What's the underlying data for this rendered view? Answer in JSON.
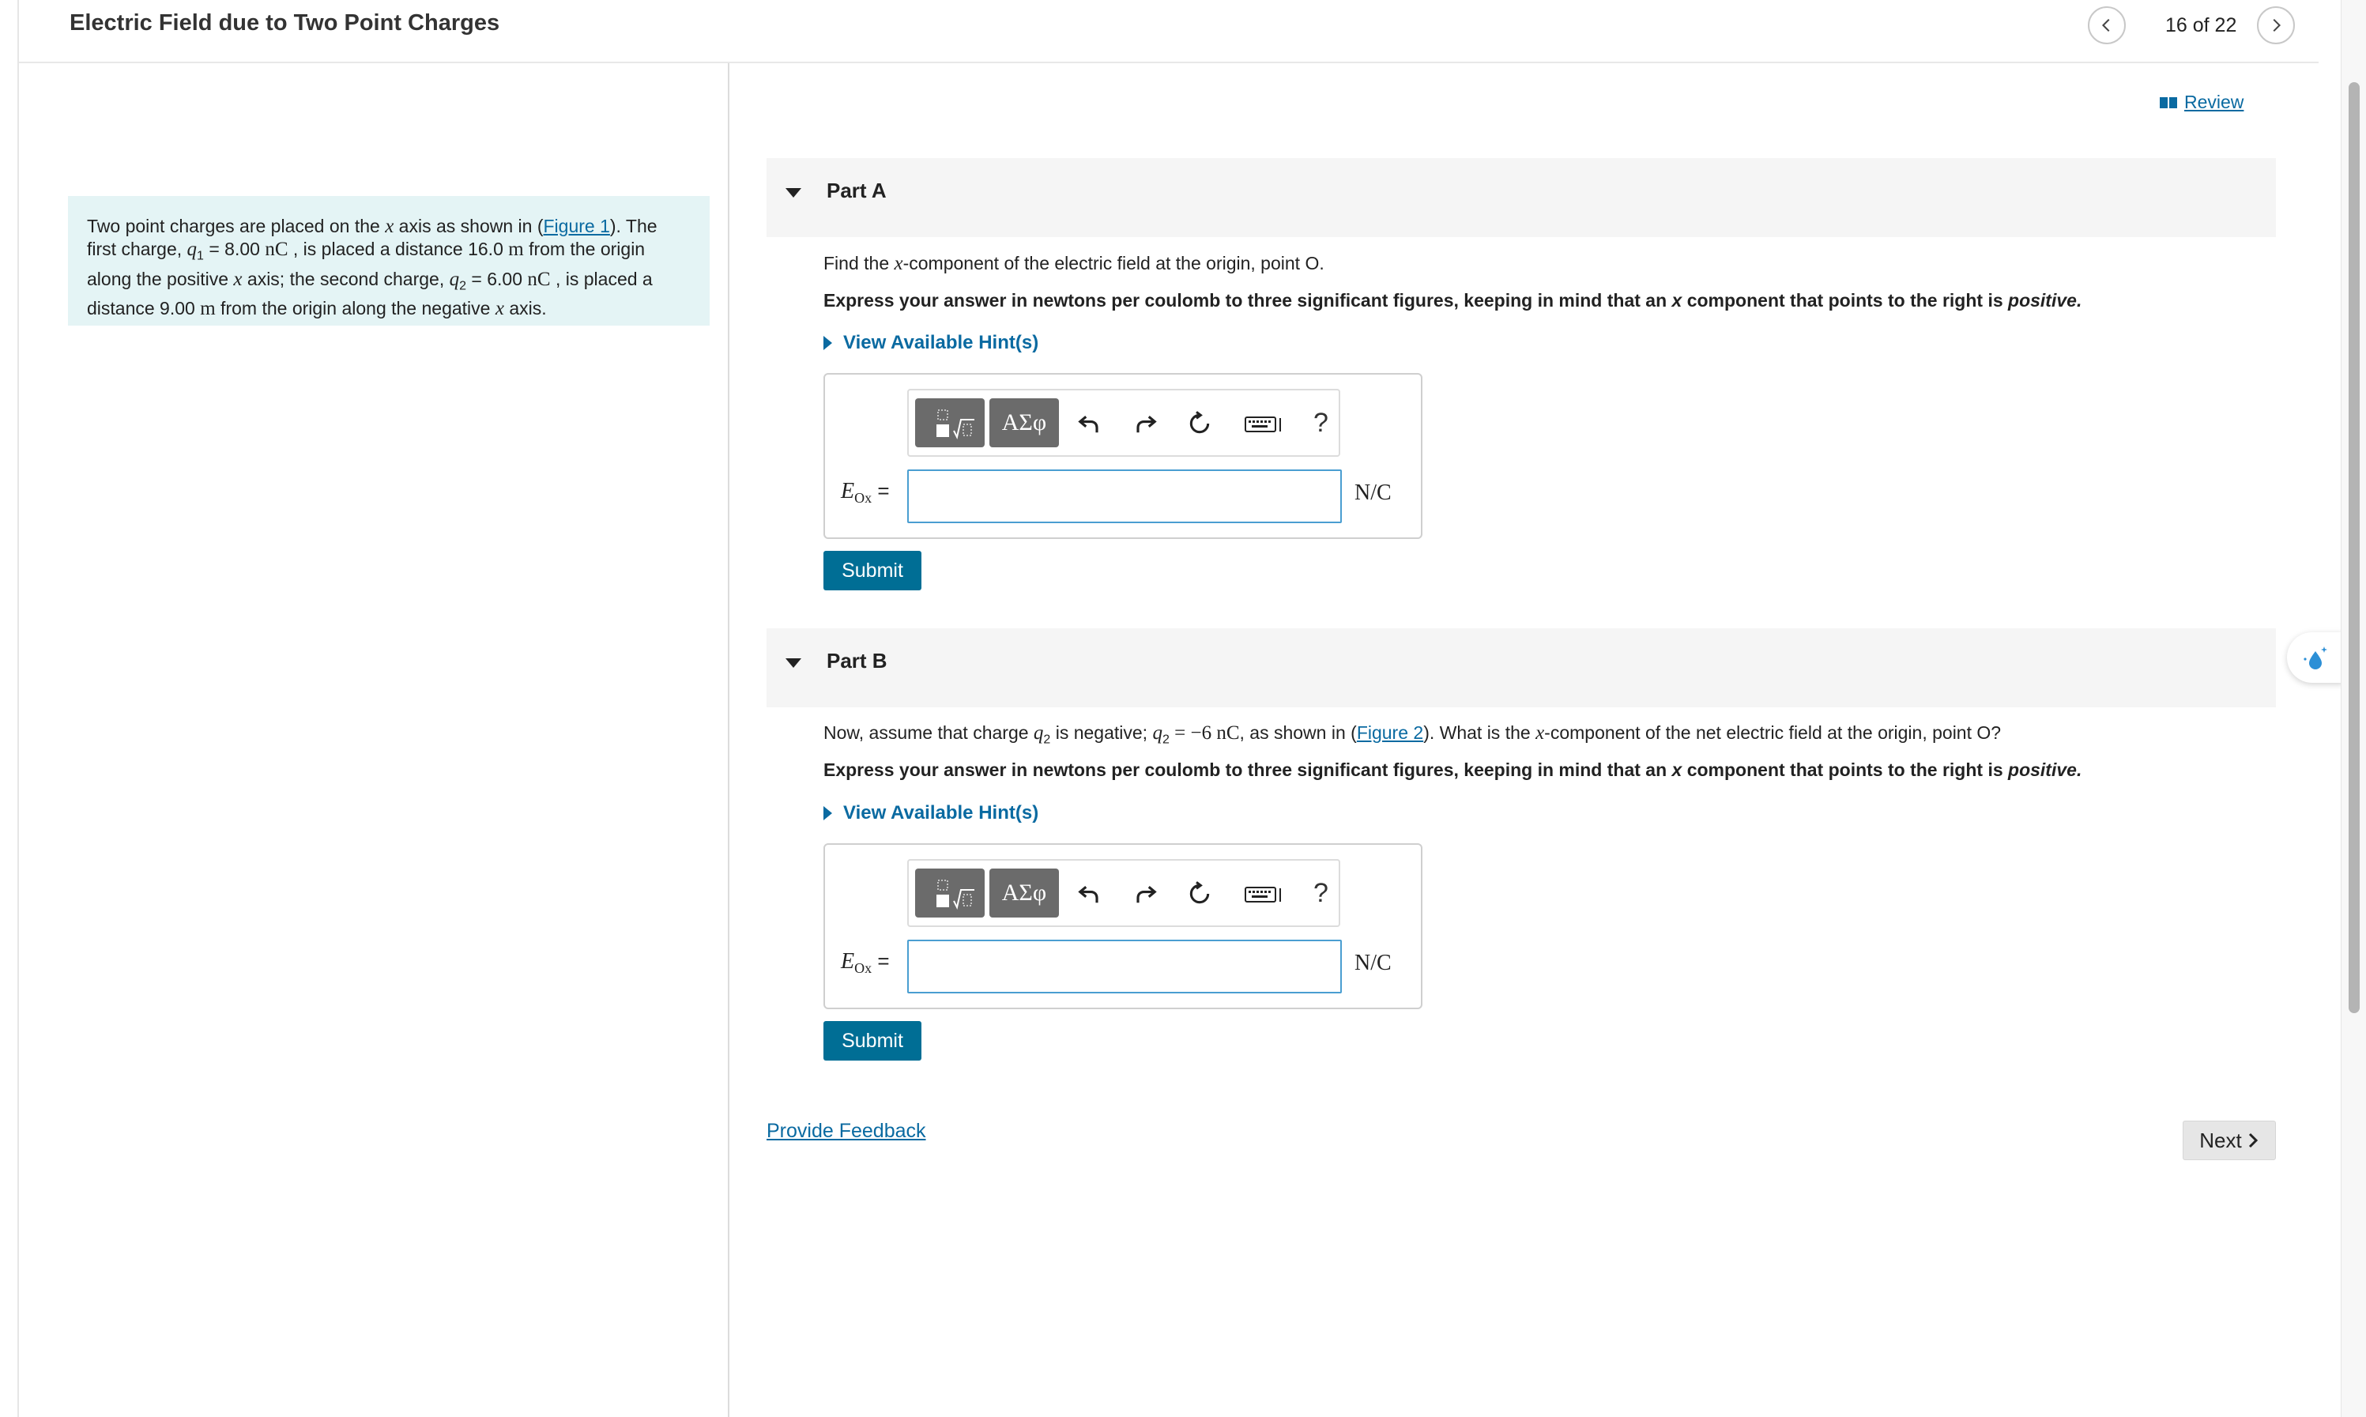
{
  "header": {
    "title": "Electric Field due to Two Point Charges",
    "page_counter": "16 of 22"
  },
  "review": {
    "label": "Review"
  },
  "intro": {
    "t1": "Two point charges are placed on the ",
    "t1_var": "x",
    "t2": " axis as shown in (",
    "figure_link": "Figure 1",
    "t3": "). The",
    "t4": "first charge, ",
    "q1_var": "q",
    "q1_sub": "1",
    "q1_val": " = 8.00 ",
    "q1_unit": "nC",
    "t5": " , is placed a distance 16.0 ",
    "m1": "m",
    "t6": " from the origin",
    "t7": "along the positive ",
    "t7_var": "x",
    "t8": " axis; the second charge, ",
    "q2_var": "q",
    "q2_sub": "2",
    "q2_val": " = 6.00 ",
    "q2_unit": "nC",
    "t9": " , is placed a",
    "t10": "distance 9.00 ",
    "m2": "m",
    "t11": " from the origin along the negative ",
    "t11_var": "x",
    "t12": " axis."
  },
  "part_a": {
    "label": "Part A",
    "q1": "Find the ",
    "q_var": "x",
    "q2": "-component of the electric field at the origin, point O.",
    "instr1": "Express your answer in newtons per coulomb to three significant figures, keeping in mind that an ",
    "instr_var": "x",
    "instr2": " component that points to the right is ",
    "instr_em": "positive.",
    "hint": "View Available Hint(s)",
    "eq_var": "E",
    "eq_sub": "Ox",
    "eq_sign": " =",
    "input_value": "",
    "unit": "N/C",
    "submit": "Submit"
  },
  "part_b": {
    "label": "Part B",
    "q1": "Now, assume that charge ",
    "q_var": "q",
    "q_sub": "2",
    "q2": " is negative; ",
    "q2_var": "q",
    "q2_sub": "2",
    "q_eq": " = −6 ",
    "q_unit": "nC",
    "q3": ", as shown in (",
    "figure_link": "Figure 2",
    "q4": "). What is the ",
    "q4_var": "x",
    "q5": "-component of the net electric field at the origin, point O?",
    "instr1": "Express your answer in newtons per coulomb to three significant figures, keeping in mind that an ",
    "instr_var": "x",
    "instr2": " component that points to the right is ",
    "instr_em": "positive.",
    "hint": "View Available Hint(s)",
    "eq_var": "E",
    "eq_sub": "Ox",
    "eq_sign": " =",
    "input_value": "",
    "unit": "N/C",
    "submit": "Submit"
  },
  "toolbar": {
    "templates_icon": "templates-icon",
    "greek_label": "ΑΣφ",
    "help_label": "?"
  },
  "footer": {
    "feedback": "Provide Feedback",
    "next": "Next"
  },
  "colors": {
    "link": "#0a6aa1",
    "submit_bg": "#006e95",
    "intro_bg": "#e4f4f5",
    "part_header_bg": "#f5f5f5",
    "toolbar_btn": "#6b6b6b"
  }
}
